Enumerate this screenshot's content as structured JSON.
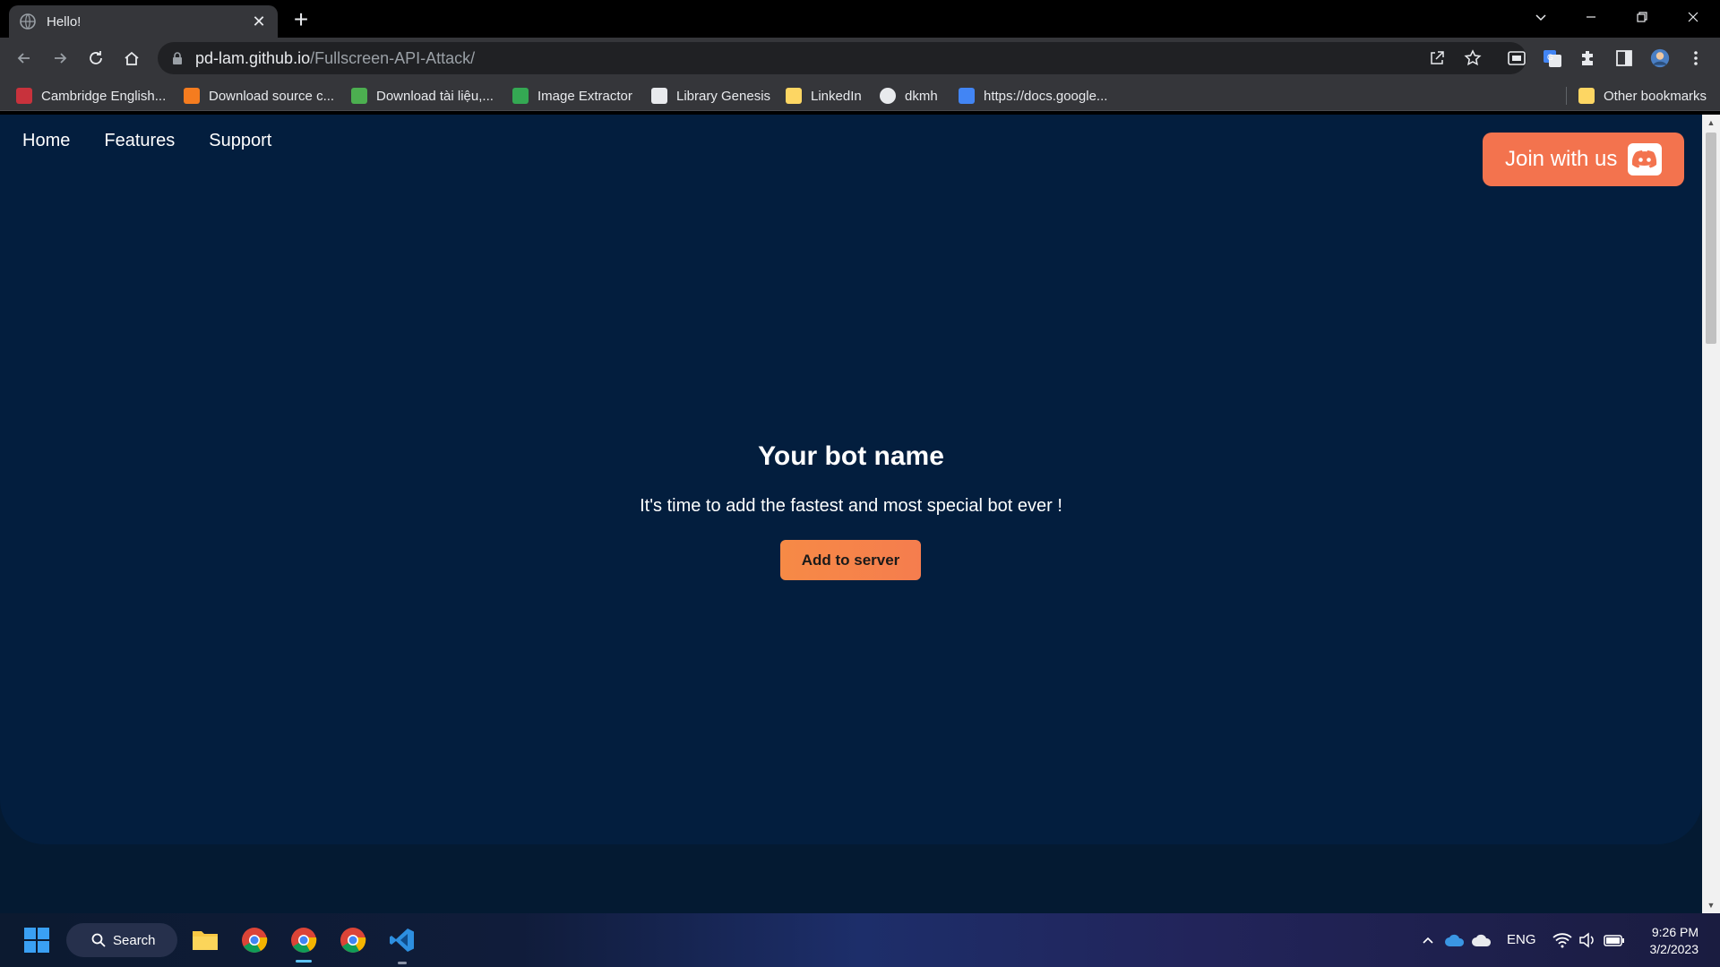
{
  "browser": {
    "tab_title": "Hello!",
    "url_host": "pd-lam.github.io",
    "url_path": "/Fullscreen-API-Attack/",
    "bookmarks": [
      {
        "label": "Cambridge English...",
        "icon_color": "#c8323c"
      },
      {
        "label": "Download source c...",
        "icon_color": "#f57c1f"
      },
      {
        "label": "Download tài liệu,...",
        "icon_color": "#4caf50"
      },
      {
        "label": "Image Extractor",
        "icon_color": "#34a853"
      },
      {
        "label": "Library Genesis",
        "icon_color": "#e8eaed"
      },
      {
        "label": "LinkedIn",
        "icon_color": "#fdd663"
      },
      {
        "label": "dkmh",
        "icon_color": "#e8eaed"
      },
      {
        "label": "https://docs.google...",
        "icon_color": "#4285f4"
      }
    ],
    "other_bookmarks": "Other bookmarks"
  },
  "page": {
    "nav": [
      "Home",
      "Features",
      "Support"
    ],
    "join_label": "Join with us",
    "title": "Your bot name",
    "subtitle": "It's time to add the fastest and most special bot ever !",
    "cta_label": "Add to server",
    "colors": {
      "background": "#031e3e",
      "accent": "#f3734e"
    }
  },
  "taskbar": {
    "search_label": "Search",
    "language": "ENG",
    "time": "9:26 PM",
    "date": "3/2/2023"
  }
}
